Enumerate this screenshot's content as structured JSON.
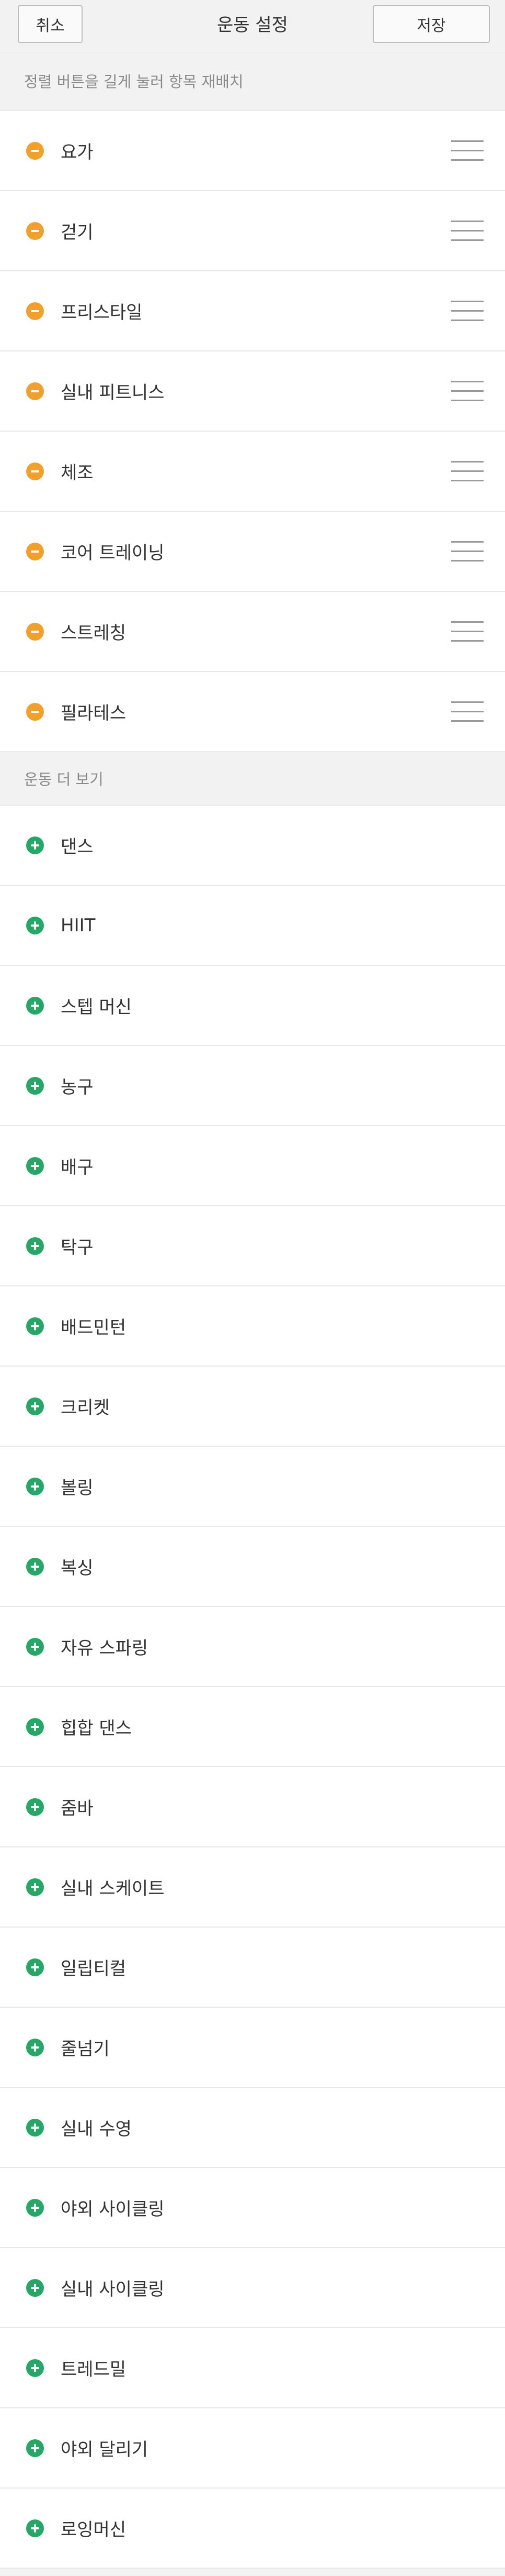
{
  "header": {
    "cancel_label": "취소",
    "title": "운동 설정",
    "save_label": "저장"
  },
  "hint": "정렬 버튼을 길게 눌러 항목 재배치",
  "selected": {
    "items": [
      "요가",
      "걷기",
      "프리스타일",
      "실내 피트니스",
      "체조",
      "코어 트레이닝",
      "스트레칭",
      "필라테스"
    ]
  },
  "more": {
    "title": "운동 더 보기",
    "items": [
      "댄스",
      "HIIT",
      "스텝 머신",
      "농구",
      "배구",
      "탁구",
      "배드민턴",
      "크리켓",
      "볼링",
      "복싱",
      "자유 스파링",
      "힙합 댄스",
      "줌바",
      "실내 스케이트",
      "일립티컬",
      "줄넘기",
      "실내 수영",
      "야외 사이클링",
      "실내 사이클링",
      "트레드밀",
      "야외 달리기",
      "로잉머신"
    ]
  },
  "icons": {
    "remove": "minus-circle-icon",
    "add": "plus-circle-icon",
    "reorder": "drag-handle-icon"
  },
  "colors": {
    "remove": "#f1a12b",
    "add": "#25a865",
    "background": "#f2f2f2"
  }
}
